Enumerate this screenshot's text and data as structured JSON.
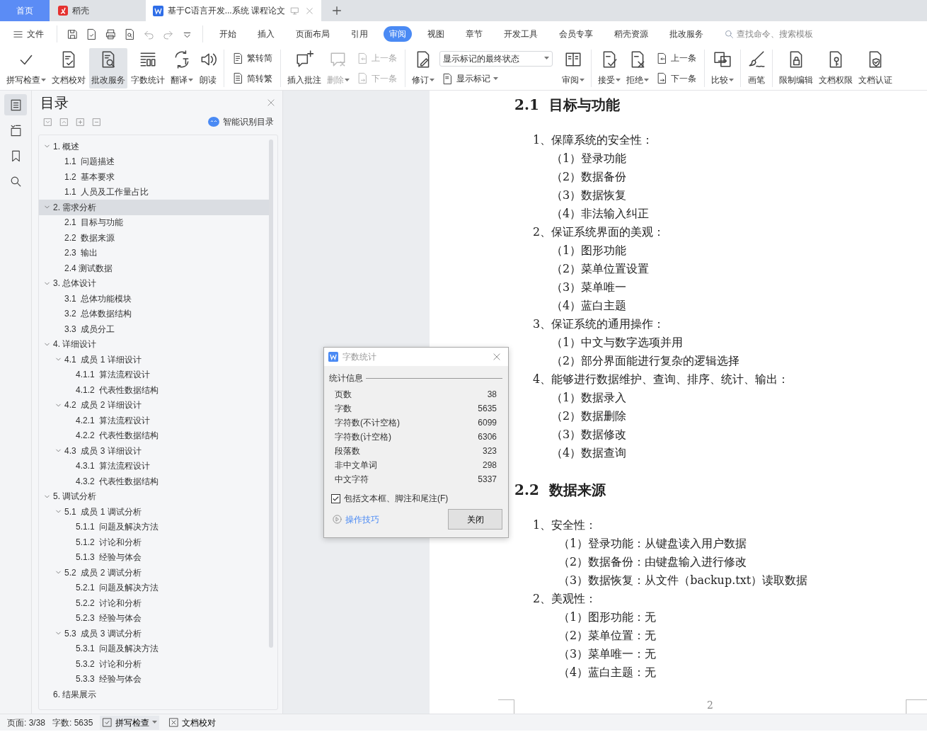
{
  "tabs": [
    {
      "label": "首页",
      "kind": "home",
      "selected": false
    },
    {
      "label": "稻壳",
      "kind": "app",
      "selected": false
    },
    {
      "label": "基于C语言开发...系统 课程论文",
      "kind": "doc",
      "selected": true
    }
  ],
  "menu": {
    "file": "文件",
    "tabs": [
      {
        "label": "开始",
        "selected": false
      },
      {
        "label": "插入",
        "selected": false
      },
      {
        "label": "页面布局",
        "selected": false
      },
      {
        "label": "引用",
        "selected": false
      },
      {
        "label": "审阅",
        "selected": true
      },
      {
        "label": "视图",
        "selected": false
      },
      {
        "label": "章节",
        "selected": false
      },
      {
        "label": "开发工具",
        "selected": false
      },
      {
        "label": "会员专享",
        "selected": false
      },
      {
        "label": "稻壳资源",
        "selected": false
      },
      {
        "label": "批改服务",
        "selected": false
      }
    ],
    "search": {
      "placeholder": "查找命令、搜索模板"
    }
  },
  "ribbon": [
    [
      {
        "kind": "large",
        "label": "拼写检查",
        "dropdown": true,
        "selected": false,
        "disabled": false
      },
      {
        "kind": "large",
        "label": "文档校对",
        "dropdown": false,
        "selected": false,
        "disabled": false
      },
      {
        "kind": "large",
        "label": "批改服务",
        "dropdown": false,
        "selected": true,
        "disabled": false
      },
      {
        "kind": "large",
        "label": "字数统计",
        "dropdown": false,
        "selected": false,
        "disabled": false
      },
      {
        "kind": "large",
        "label": "翻译",
        "dropdown": true,
        "selected": false,
        "disabled": false
      },
      {
        "kind": "large",
        "label": "朗读",
        "dropdown": false,
        "selected": false,
        "disabled": false
      }
    ],
    [
      {
        "kind": "stack",
        "items": [
          {
            "label": "繁转简",
            "disabled": false
          },
          {
            "label": "简转繁",
            "disabled": false
          }
        ]
      }
    ],
    [
      {
        "kind": "large",
        "label": "插入批注",
        "dropdown": false,
        "selected": false,
        "disabled": false
      },
      {
        "kind": "large",
        "label": "删除",
        "dropdown": true,
        "selected": false,
        "disabled": true
      },
      {
        "kind": "stack",
        "items": [
          {
            "label": "上一条",
            "disabled": true
          },
          {
            "label": "下一条",
            "disabled": true
          }
        ]
      }
    ],
    [
      {
        "kind": "large",
        "label": "修订",
        "dropdown": true,
        "selected": false,
        "disabled": false
      },
      {
        "kind": "select",
        "value": "显示标记的最终状态",
        "below": "显示标记"
      },
      {
        "kind": "large",
        "label": "审阅",
        "dropdown": true,
        "selected": false,
        "disabled": false
      }
    ],
    [
      {
        "kind": "large",
        "label": "接受",
        "dropdown": true,
        "selected": false,
        "disabled": false
      },
      {
        "kind": "large",
        "label": "拒绝",
        "dropdown": true,
        "selected": false,
        "disabled": false
      },
      {
        "kind": "stack",
        "items": [
          {
            "label": "上一条",
            "disabled": false
          },
          {
            "label": "下一条",
            "disabled": false
          }
        ]
      }
    ],
    [
      {
        "kind": "large",
        "label": "比较",
        "dropdown": true,
        "selected": false,
        "disabled": false
      }
    ],
    [
      {
        "kind": "large",
        "label": "画笔",
        "dropdown": false,
        "selected": false,
        "disabled": false
      }
    ],
    [
      {
        "kind": "large",
        "label": "限制编辑",
        "dropdown": false,
        "selected": false,
        "disabled": false
      },
      {
        "kind": "large",
        "label": "文档权限",
        "dropdown": false,
        "selected": false,
        "disabled": false
      },
      {
        "kind": "large",
        "label": "文档认证",
        "dropdown": false,
        "selected": false,
        "disabled": false
      }
    ]
  ],
  "sidebar": [
    {
      "selected": true
    },
    {
      "selected": false
    },
    {
      "selected": false
    },
    {
      "selected": false
    }
  ],
  "toc": {
    "title": "目录",
    "smart": "智能识别目录",
    "items": [
      {
        "label": "1. 概述",
        "expanded": true,
        "selected": false,
        "children": [
          {
            "label": "1.1  问题描述",
            "selected": false
          },
          {
            "label": "1.2  基本要求",
            "selected": false
          },
          {
            "label": "1.1  人员及工作量占比",
            "selected": false
          }
        ]
      },
      {
        "label": "2. 需求分析",
        "expanded": true,
        "selected": true,
        "children": [
          {
            "label": "2.1  目标与功能",
            "selected": false
          },
          {
            "label": "2.2  数据来源",
            "selected": false
          },
          {
            "label": "2.3  输出",
            "selected": false
          },
          {
            "label": "2.4 测试数据",
            "selected": false
          }
        ]
      },
      {
        "label": "3. 总体设计",
        "expanded": true,
        "selected": false,
        "children": [
          {
            "label": "3.1  总体功能模块",
            "selected": false
          },
          {
            "label": "3.2  总体数据结构",
            "selected": false
          },
          {
            "label": "3.3  成员分工",
            "selected": false
          }
        ]
      },
      {
        "label": "4. 详细设计",
        "expanded": true,
        "selected": false,
        "children": [
          {
            "label": "4.1  成员 1 详细设计",
            "expanded": true,
            "selected": false,
            "children": [
              {
                "label": "4.1.1  算法流程设计",
                "selected": false
              },
              {
                "label": "4.1.2  代表性数据结构",
                "selected": false
              }
            ]
          },
          {
            "label": "4.2  成员 2 详细设计",
            "expanded": true,
            "selected": false,
            "children": [
              {
                "label": "4.2.1  算法流程设计",
                "selected": false
              },
              {
                "label": "4.2.2  代表性数据结构",
                "selected": false
              }
            ]
          },
          {
            "label": "4.3  成员 3 详细设计",
            "expanded": true,
            "selected": false,
            "children": [
              {
                "label": "4.3.1  算法流程设计",
                "selected": false
              },
              {
                "label": "4.3.2  代表性数据结构",
                "selected": false
              }
            ]
          }
        ]
      },
      {
        "label": "5. 调试分析",
        "expanded": true,
        "selected": false,
        "children": [
          {
            "label": "5.1  成员 1 调试分析",
            "expanded": true,
            "selected": false,
            "children": [
              {
                "label": "5.1.1  问题及解决方法",
                "selected": false
              },
              {
                "label": "5.1.2  讨论和分析",
                "selected": false
              },
              {
                "label": "5.1.3  经验与体会",
                "selected": false
              }
            ]
          },
          {
            "label": "5.2  成员 2 调试分析",
            "expanded": true,
            "selected": false,
            "children": [
              {
                "label": "5.2.1  问题及解决方法",
                "selected": false
              },
              {
                "label": "5.2.2  讨论和分析",
                "selected": false
              },
              {
                "label": "5.2.3  经验与体会",
                "selected": false
              }
            ]
          },
          {
            "label": "5.3  成员 3 调试分析",
            "expanded": true,
            "selected": false,
            "children": [
              {
                "label": "5.3.1  问题及解决方法",
                "selected": false
              },
              {
                "label": "5.3.2  讨论和分析",
                "selected": false
              },
              {
                "label": "5.3.3  经验与体会",
                "selected": false
              }
            ]
          }
        ]
      },
      {
        "label": "6. 结果展示",
        "selected": false
      }
    ]
  },
  "document": {
    "lines": [
      {
        "kind": "heading",
        "text": "2.1  目标与功能"
      },
      {
        "kind": "item",
        "text": "1、保障系统的安全性："
      },
      {
        "kind": "sub",
        "text": "（1）登录功能"
      },
      {
        "kind": "sub",
        "text": "（2）数据备份"
      },
      {
        "kind": "sub",
        "text": "（3）数据恢复"
      },
      {
        "kind": "sub",
        "text": "（4）非法输入纠正"
      },
      {
        "kind": "item",
        "text": "2、保证系统界面的美观："
      },
      {
        "kind": "sub",
        "text": "（1）图形功能"
      },
      {
        "kind": "sub",
        "text": "（2）菜单位置设置"
      },
      {
        "kind": "sub",
        "text": "（3）菜单唯一"
      },
      {
        "kind": "sub",
        "text": "（4）蓝白主题"
      },
      {
        "kind": "item",
        "text": "3、保证系统的通用操作："
      },
      {
        "kind": "sub",
        "text": "（1）中文与数字选项并用"
      },
      {
        "kind": "sub",
        "text": "（2）部分界面能进行复杂的逻辑选择"
      },
      {
        "kind": "item",
        "text": "4、能够进行数据维护、查询、排序、统计、输出："
      },
      {
        "kind": "sub",
        "text": "（1）数据录入"
      },
      {
        "kind": "sub",
        "text": "（2）数据删除"
      },
      {
        "kind": "sub",
        "text": "（3）数据修改"
      },
      {
        "kind": "sub",
        "text": "（4）数据查询"
      },
      {
        "kind": "heading",
        "text": "2.2  数据来源"
      },
      {
        "kind": "item",
        "text": "1、安全性："
      },
      {
        "kind": "detail",
        "text": "（1）登录功能：从键盘读入用户数据"
      },
      {
        "kind": "detail",
        "text": "（2）数据备份：由键盘输入进行修改"
      },
      {
        "kind": "detail",
        "text": "（3）数据恢复：从文件（backup.txt）读取数据"
      },
      {
        "kind": "item",
        "text": "2、美观性："
      },
      {
        "kind": "detail",
        "text": "（1）图形功能：无"
      },
      {
        "kind": "detail",
        "text": "（2）菜单位置：无"
      },
      {
        "kind": "detail",
        "text": "（3）菜单唯一：无"
      },
      {
        "kind": "detail",
        "text": "（4）蓝白主题：无"
      }
    ],
    "page_number": "2"
  },
  "dialog": {
    "title": "字数统计",
    "section": "统计信息",
    "rows": [
      {
        "label": "页数",
        "value": "38"
      },
      {
        "label": "字数",
        "value": "5635"
      },
      {
        "label": "字符数(不计空格)",
        "value": "6099"
      },
      {
        "label": "字符数(计空格)",
        "value": "6306"
      },
      {
        "label": "段落数",
        "value": "323"
      },
      {
        "label": "非中文单词",
        "value": "298"
      },
      {
        "label": "中文字符",
        "value": "5337"
      }
    ],
    "include": {
      "label": "包括文本框、脚注和尾注(F)",
      "checked": true
    },
    "tips": "操作技巧",
    "close": "关闭"
  },
  "status": {
    "page": "页面: 3/38",
    "words": "字数: 5635",
    "buttons": [
      {
        "label": "拼写检查",
        "dropdown": true
      },
      {
        "label": "文档校对",
        "dropdown": false
      }
    ]
  }
}
